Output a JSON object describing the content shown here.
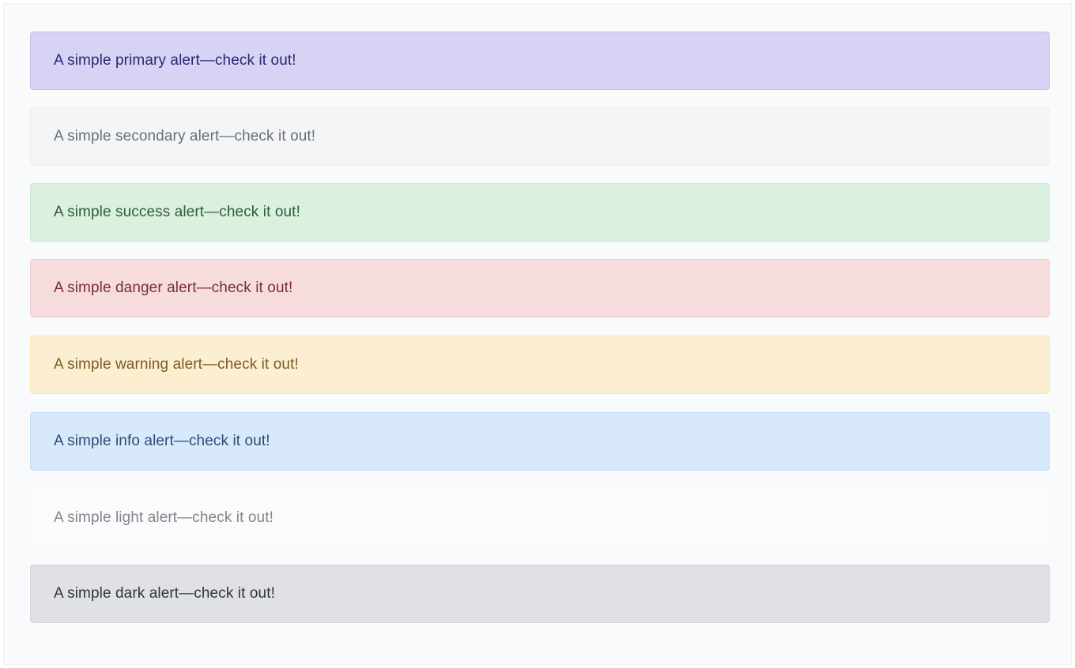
{
  "alerts": [
    {
      "variant": "primary",
      "text": "A simple primary alert—check it out!",
      "bg": "#d6d3f5",
      "border": "#c3bfee",
      "color": "#2c2673"
    },
    {
      "variant": "secondary",
      "text": "A simple secondary alert—check it out!",
      "bg": "#f4f5f7",
      "border": "#eceef1",
      "color": "#6a6f78"
    },
    {
      "variant": "success",
      "text": "A simple success alert—check it out!",
      "bg": "#dbf0df",
      "border": "#c6e7cd",
      "color": "#2d5e36"
    },
    {
      "variant": "danger",
      "text": "A simple danger alert—check it out!",
      "bg": "#f6dcdd",
      "border": "#f1c9cb",
      "color": "#7a2e33"
    },
    {
      "variant": "warning",
      "text": "A simple warning alert—check it out!",
      "bg": "#fcefd1",
      "border": "#f8e4b6",
      "color": "#7b5b24"
    },
    {
      "variant": "info",
      "text": "A simple info alert—check it out!",
      "bg": "#d9e9fc",
      "border": "#c5dcf8",
      "color": "#2a4c75"
    },
    {
      "variant": "light",
      "text": "A simple light alert—check it out!",
      "bg": "#fbfbfc",
      "border": "#f6f7f9",
      "color": "#80858e"
    },
    {
      "variant": "dark",
      "text": "A simple dark alert—check it out!",
      "bg": "#dfe1e4",
      "border": "#d2d5d9",
      "color": "#2f343a"
    }
  ]
}
